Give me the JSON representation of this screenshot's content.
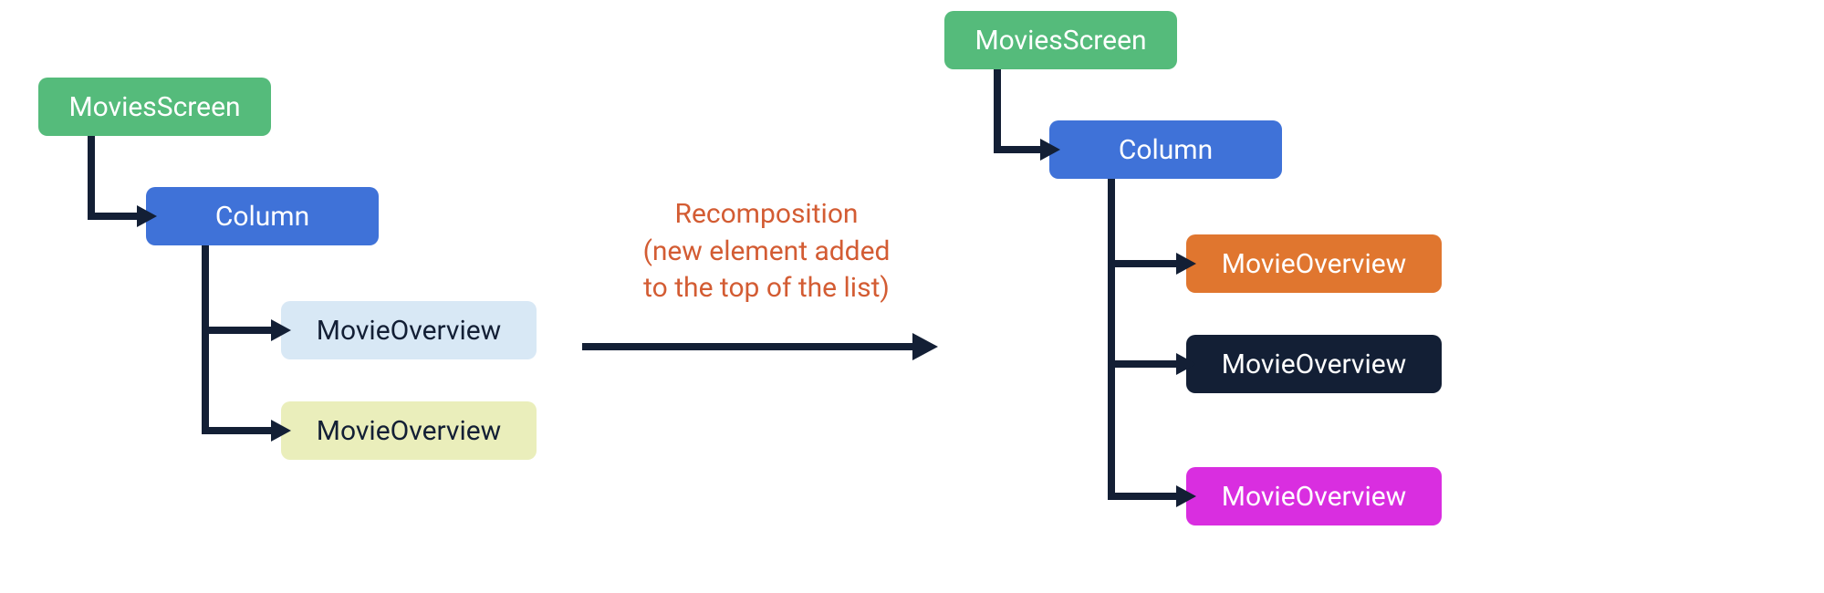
{
  "left": {
    "root": {
      "label": "MoviesScreen",
      "bg": "#55bb7b",
      "fg": "#ffffff"
    },
    "column": {
      "label": "Column",
      "bg": "#3f72d8",
      "fg": "#ffffff"
    },
    "item1": {
      "label": "MovieOverview",
      "bg": "#d8e8f5",
      "fg": "#131f35"
    },
    "item2": {
      "label": "MovieOverview",
      "bg": "#eaeebb",
      "fg": "#131f35"
    }
  },
  "caption": {
    "line1": "Recomposition",
    "line2": "(new element added",
    "line3": "to the top of the list)"
  },
  "right": {
    "root": {
      "label": "MoviesScreen",
      "bg": "#55bb7b",
      "fg": "#ffffff"
    },
    "column": {
      "label": "Column",
      "bg": "#3f72d8",
      "fg": "#ffffff"
    },
    "item1": {
      "label": "MovieOverview",
      "bg": "#e0762f",
      "fg": "#ffffff"
    },
    "item2": {
      "label": "MovieOverview",
      "bg": "#131f35",
      "fg": "#ffffff"
    },
    "item3": {
      "label": "MovieOverview",
      "bg": "#d92ee0",
      "fg": "#ffffff"
    }
  },
  "stroke": "#131f35"
}
